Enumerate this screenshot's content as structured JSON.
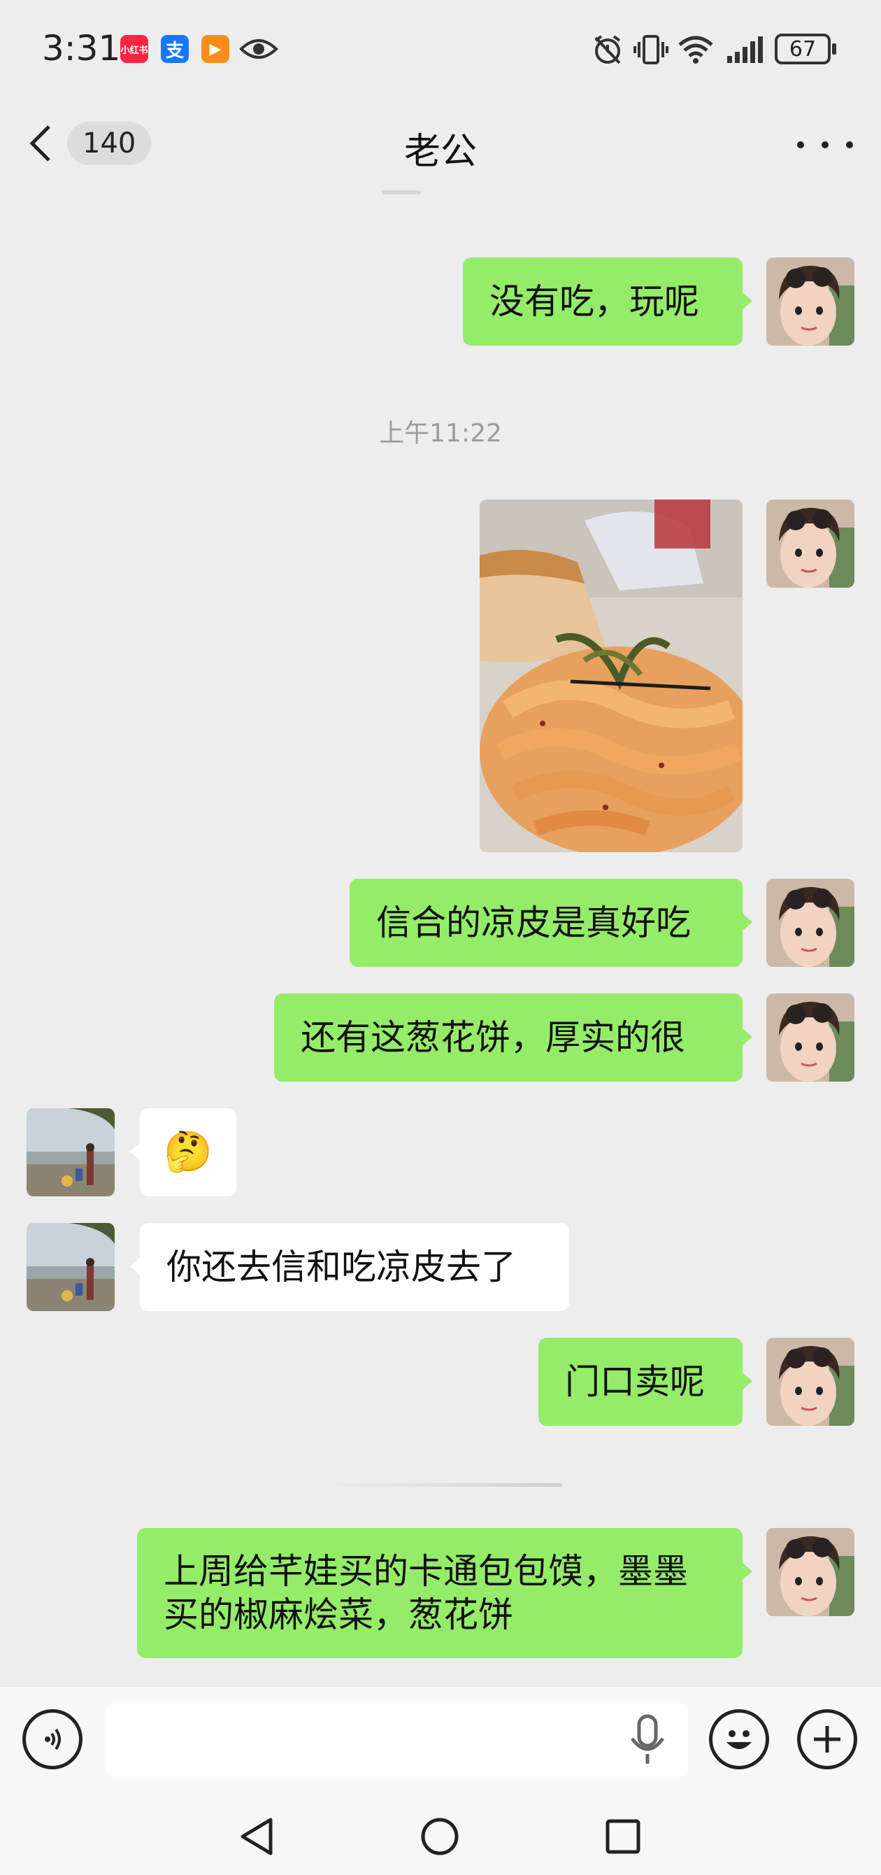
{
  "status_bar": {
    "time": "3:31",
    "apps": [
      {
        "label": "小红书",
        "color": "#ff2442"
      },
      {
        "label": "支",
        "color": "#1677ff"
      },
      {
        "label": "▶",
        "color": "#ff8c1a"
      }
    ],
    "battery": "67"
  },
  "header": {
    "unread_count": "140",
    "title": "老公"
  },
  "messages": {
    "m1": "没有吃，玩呢",
    "time1": "上午11:22",
    "m3": "信合的凉皮是真好吃",
    "m4": "还有这葱花饼，厚实的很",
    "m5_emoji": "🤔",
    "m6": "你还去信和吃凉皮去了",
    "m7": "门口卖呢",
    "m8": "上周给芊娃买的卡通包包馍，墨墨买的椒麻烩菜，葱花饼"
  },
  "input": {
    "placeholder": ""
  },
  "colors": {
    "background": "#ededed",
    "my_bubble": "#95ec69",
    "their_bubble": "#ffffff"
  }
}
